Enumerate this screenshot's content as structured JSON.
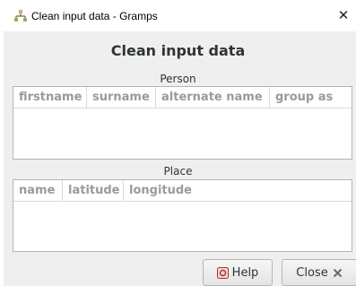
{
  "window": {
    "title": "Clean input data - Gramps",
    "close_glyph": "✕"
  },
  "dialog": {
    "heading": "Clean input data"
  },
  "person": {
    "label": "Person",
    "columns": [
      "firstname",
      "surname",
      "alternate name",
      "group as"
    ]
  },
  "place": {
    "label": "Place",
    "columns": [
      "name",
      "latitude",
      "longitude"
    ]
  },
  "buttons": {
    "help_label": "Help",
    "close_label": "Close"
  },
  "icons": {
    "app": "gramps-icon",
    "help": "help-icon",
    "close": "close-icon"
  }
}
